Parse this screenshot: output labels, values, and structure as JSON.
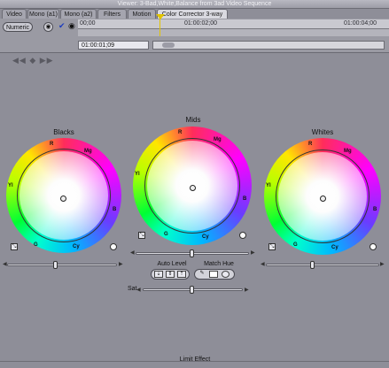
{
  "window": {
    "title": "Viewer: 3-Bad,White,Balance from 3ad Video Sequence"
  },
  "tabs": [
    {
      "label": "Video"
    },
    {
      "label": "Mono (a1)"
    },
    {
      "label": "Mono (a2)"
    },
    {
      "label": "Filters"
    },
    {
      "label": "Motion"
    },
    {
      "label": "Color Corrector 3-way"
    }
  ],
  "toolbar": {
    "numeric_label": "Numeric",
    "ruler_start": "00;00",
    "ruler_mid": "01:00:02;00",
    "ruler_end": "01:00:04;00",
    "timecode": "01:00:01;09"
  },
  "wheels": [
    {
      "title": "Blacks",
      "labels": {
        "r": "R",
        "mg": "Mg",
        "yl": "Yl",
        "b": "B",
        "g": "G",
        "cy": "Cy"
      }
    },
    {
      "title": "Mids",
      "labels": {
        "r": "R",
        "mg": "Mg",
        "yl": "Yl",
        "b": "B",
        "g": "G",
        "cy": "Cy"
      }
    },
    {
      "title": "Whites",
      "labels": {
        "r": "R",
        "mg": "Mg",
        "yl": "Yl",
        "b": "B",
        "g": "G",
        "cy": "Cy"
      }
    }
  ],
  "controls": {
    "auto_level_label": "Auto Level",
    "match_hue_label": "Match Hue",
    "sat_label": "Sat",
    "limit_effect_label": "Limit Effect"
  },
  "colors": {
    "background": "#8e8e98",
    "playhead": "#e2c400"
  }
}
